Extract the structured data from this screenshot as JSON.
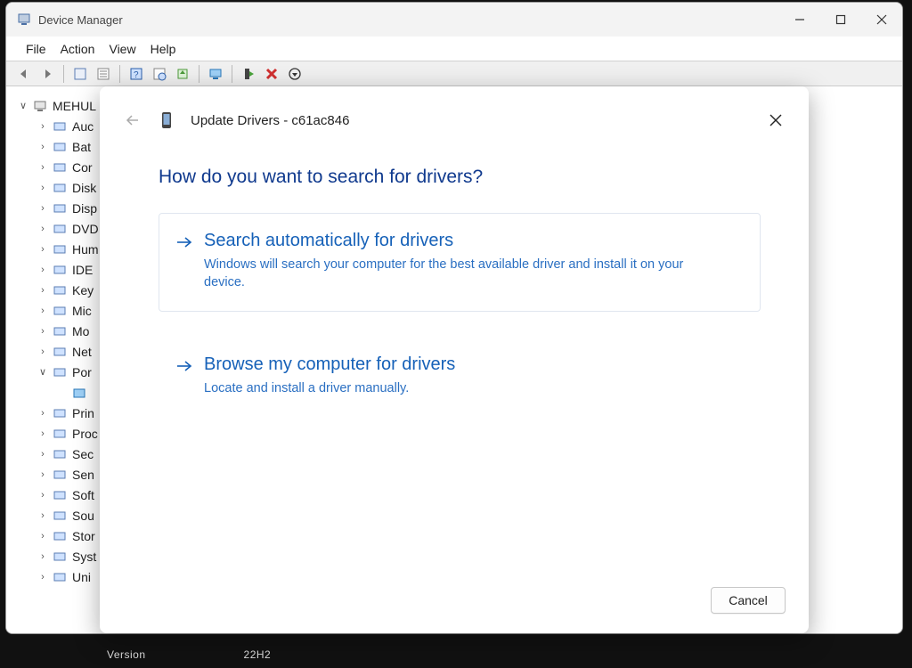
{
  "window": {
    "title": "Device Manager"
  },
  "menubar": [
    "File",
    "Action",
    "View",
    "Help"
  ],
  "tree": {
    "root": "MEHUL",
    "items": [
      {
        "label": "Auc"
      },
      {
        "label": "Bat"
      },
      {
        "label": "Cor"
      },
      {
        "label": "Disk"
      },
      {
        "label": "Disp"
      },
      {
        "label": "DVD"
      },
      {
        "label": "Hum"
      },
      {
        "label": "IDE"
      },
      {
        "label": "Key"
      },
      {
        "label": "Mic"
      },
      {
        "label": "Mo"
      },
      {
        "label": "Net"
      },
      {
        "label": "Por",
        "expanded": true,
        "children": [
          {
            "label": ""
          }
        ]
      },
      {
        "label": "Prin"
      },
      {
        "label": "Proc"
      },
      {
        "label": "Sec"
      },
      {
        "label": "Sen"
      },
      {
        "label": "Soft"
      },
      {
        "label": "Sou"
      },
      {
        "label": "Stor"
      },
      {
        "label": "Syst"
      },
      {
        "label": "Uni"
      }
    ]
  },
  "modal": {
    "header": "Update Drivers - c61ac846",
    "question": "How do you want to search for drivers?",
    "options": [
      {
        "title": "Search automatically for drivers",
        "desc": "Windows will search your computer for the best available driver and install it on your device."
      },
      {
        "title": "Browse my computer for drivers",
        "desc": "Locate and install a driver manually."
      }
    ],
    "cancel": "Cancel"
  },
  "statusbar": {
    "left": "Version",
    "right": "22H2"
  }
}
